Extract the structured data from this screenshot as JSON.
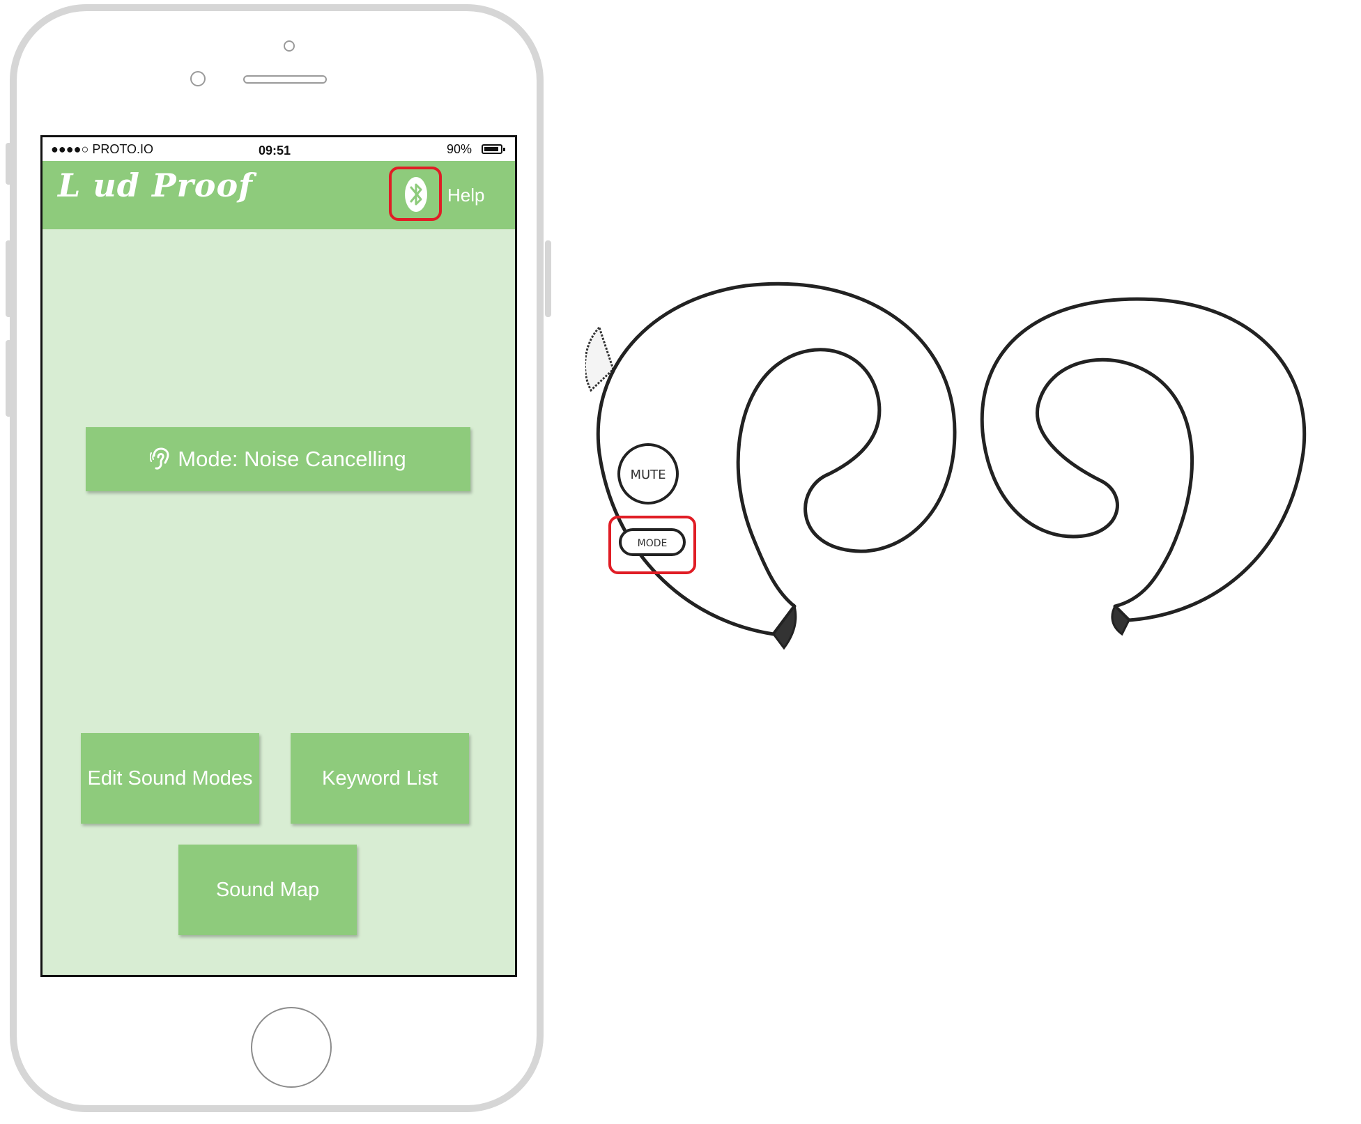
{
  "status_bar": {
    "carrier": "●●●●○ PROTO.IO",
    "time": "09:51",
    "battery_percent": "90%",
    "battery_level": 0.9
  },
  "header": {
    "logo": "L ud Proof",
    "logo_icon": "ear-icon",
    "bluetooth_icon": "bluetooth-icon",
    "help_label": "Help"
  },
  "main": {
    "mode_button_label": "Mode: Noise Cancelling",
    "edit_sound_modes_label": "Edit Sound Modes",
    "keyword_list_label": "Keyword List",
    "sound_map_label": "Sound Map"
  },
  "device": {
    "mute_label": "MUTE",
    "mode_label": "MODE"
  },
  "colors": {
    "accent": "#8ecb7c",
    "screen_bg": "#d8edd3",
    "highlight": "#e01d25"
  }
}
